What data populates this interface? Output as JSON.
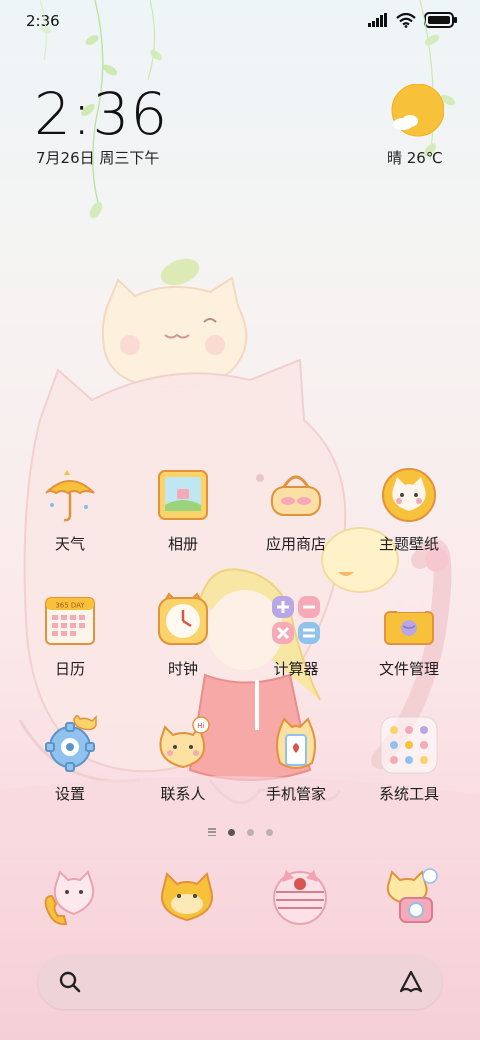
{
  "status": {
    "time": "2:36"
  },
  "lockclock": {
    "time": "2:36",
    "date": "7月26日 周三下午"
  },
  "weather": {
    "text": "晴 26℃"
  },
  "apps": [
    {
      "label": "天气"
    },
    {
      "label": "相册"
    },
    {
      "label": "应用商店"
    },
    {
      "label": "主题壁纸"
    },
    {
      "label": "日历"
    },
    {
      "label": "时钟"
    },
    {
      "label": "计算器"
    },
    {
      "label": "文件管理"
    },
    {
      "label": "设置"
    },
    {
      "label": "联系人"
    },
    {
      "label": "手机管家"
    },
    {
      "label": "系统工具"
    }
  ],
  "calendar_icon": {
    "text": "365 DAY"
  },
  "contacts_icon": {
    "badge": "Hi"
  },
  "page_indicator": {
    "current": 1,
    "total": 3
  },
  "dock": [
    {
      "icon": "phone-cat-icon"
    },
    {
      "icon": "message-cat-icon"
    },
    {
      "icon": "browser-cat-icon"
    },
    {
      "icon": "camera-cat-icon"
    }
  ],
  "colors": {
    "accent_yellow": "#f7c23a",
    "accent_pink": "#f4a6b4",
    "outline": "#e2923b"
  }
}
